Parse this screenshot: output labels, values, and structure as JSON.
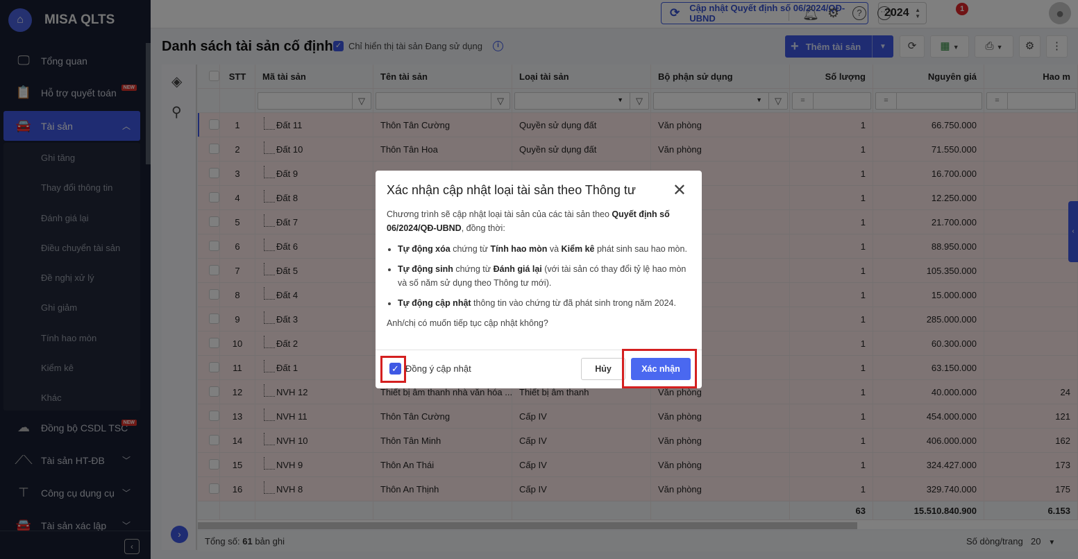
{
  "app": {
    "name": "MISA QLTS"
  },
  "sidebar": {
    "items": [
      {
        "label": "Tổng quan",
        "icon": "monitor-chart-icon"
      },
      {
        "label": "Hỗ trợ quyết toán",
        "icon": "clipboard-icon",
        "badge": "NEW"
      },
      {
        "label": "Tài sản",
        "icon": "house-car-icon",
        "active": true
      }
    ],
    "submenu": [
      "Ghi tăng",
      "Thay đổi thông tin",
      "Đánh giá lại",
      "Điều chuyển tài sản",
      "Đề nghị xử lý",
      "Ghi giảm",
      "Tính hao mòn",
      "Kiểm kê",
      "Khác"
    ],
    "items_after": [
      {
        "label": "Đồng bộ CSDL TSC",
        "icon": "cloud-upload-icon",
        "badge": "NEW"
      },
      {
        "label": "Tài sản HT-ĐB",
        "icon": "road-icon"
      },
      {
        "label": "Công cụ dụng cụ",
        "icon": "paint-roller-icon"
      },
      {
        "label": "Tài sản xác lập",
        "icon": "house-car-icon"
      }
    ]
  },
  "topbar": {
    "update_button": "Cập nhật Quyết định số 06/2024/QĐ-UBND",
    "year": "2024",
    "notification_count": "1"
  },
  "page": {
    "title": "Danh sách tài sản cố định",
    "only_in_use_label": "Chỉ hiển thị tài sản Đang sử dụng",
    "add_button": "Thêm tài sản"
  },
  "table": {
    "columns": [
      "STT",
      "Mã tài sản",
      "Tên tài sản",
      "Loại tài sản",
      "Bộ phận sử dụng",
      "Số lượng",
      "Nguyên giá",
      "Hao m"
    ],
    "filter_operator": "=",
    "rows": [
      [
        "1",
        "Đất 11",
        "Thôn Tân Cường",
        "Quyền sử dụng đất",
        "Văn phòng",
        "1",
        "66.750.000",
        ""
      ],
      [
        "2",
        "Đất 10",
        "Thôn Tân Hoa",
        "Quyền sử dụng đất",
        "Văn phòng",
        "1",
        "71.550.000",
        ""
      ],
      [
        "3",
        "Đất 9",
        "",
        "",
        "",
        "1",
        "16.700.000",
        ""
      ],
      [
        "4",
        "Đất 8",
        "",
        "",
        "",
        "1",
        "12.250.000",
        ""
      ],
      [
        "5",
        "Đất 7",
        "",
        "",
        "",
        "1",
        "21.700.000",
        ""
      ],
      [
        "6",
        "Đất 6",
        "",
        "",
        "",
        "1",
        "88.950.000",
        ""
      ],
      [
        "7",
        "Đất 5",
        "",
        "",
        "",
        "1",
        "105.350.000",
        ""
      ],
      [
        "8",
        "Đất 4",
        "",
        "",
        "",
        "1",
        "15.000.000",
        ""
      ],
      [
        "9",
        "Đất 3",
        "",
        "",
        "",
        "1",
        "285.000.000",
        ""
      ],
      [
        "10",
        "Đất 2",
        "",
        "",
        "",
        "1",
        "60.300.000",
        ""
      ],
      [
        "11",
        "Đất 1",
        "",
        "",
        "",
        "1",
        "63.150.000",
        ""
      ],
      [
        "12",
        "NVH 12",
        "Thiết bị âm thanh nhà văn hóa ...",
        "Thiết bị âm thanh",
        "Văn phòng",
        "1",
        "40.000.000",
        "24"
      ],
      [
        "13",
        "NVH 11",
        "Thôn Tân Cường",
        "Cấp IV",
        "Văn phòng",
        "1",
        "454.000.000",
        "121"
      ],
      [
        "14",
        "NVH 10",
        "Thôn Tân Minh",
        "Cấp IV",
        "Văn phòng",
        "1",
        "406.000.000",
        "162"
      ],
      [
        "15",
        "NVH 9",
        "Thôn An Thái",
        "Cấp IV",
        "Văn phòng",
        "1",
        "324.427.000",
        "173"
      ],
      [
        "16",
        "NVH 8",
        "Thôn An Thịnh",
        "Cấp IV",
        "Văn phòng",
        "1",
        "329.740.000",
        "175"
      ]
    ],
    "totals": {
      "quantity": "63",
      "original_cost": "15.510.840.900",
      "depreciation": "6.153"
    }
  },
  "footer": {
    "total_label": "Tổng số:",
    "total_count": "61",
    "total_suffix": "bản ghi",
    "page_size_label": "Số dòng/trang",
    "page_size": "20"
  },
  "dialog": {
    "title": "Xác nhận cập nhật loại tài sản theo Thông tư",
    "intro_1": "Chương trình sẽ cập nhật loại tài sản của các tài sản theo ",
    "intro_bold": "Quyết định số 06/2024/QĐ-UBND",
    "intro_2": ", đồng thời:",
    "b1_bold1": "Tự động xóa",
    "b1_t1": " chứng từ ",
    "b1_bold2": "Tính hao mòn",
    "b1_t2": " và ",
    "b1_bold3": "Kiểm kê",
    "b1_t3": " phát sinh sau hao mòn.",
    "b2_bold1": "Tự động sinh",
    "b2_t1": " chứng từ ",
    "b2_bold2": "Đánh giá lại",
    "b2_t2": " (với tài sản có thay đổi tỷ lệ hao mòn và số năm sử dụng theo Thông tư mới).",
    "b3_bold1": "Tự động cập nhật",
    "b3_t1": " thông tin vào chứng từ đã phát sinh trong năm 2024.",
    "question": "Anh/chị có muốn tiếp tục cập nhật không?",
    "agree_label": "Đồng ý cập nhật",
    "cancel": "Hủy",
    "confirm": "Xác nhận"
  }
}
